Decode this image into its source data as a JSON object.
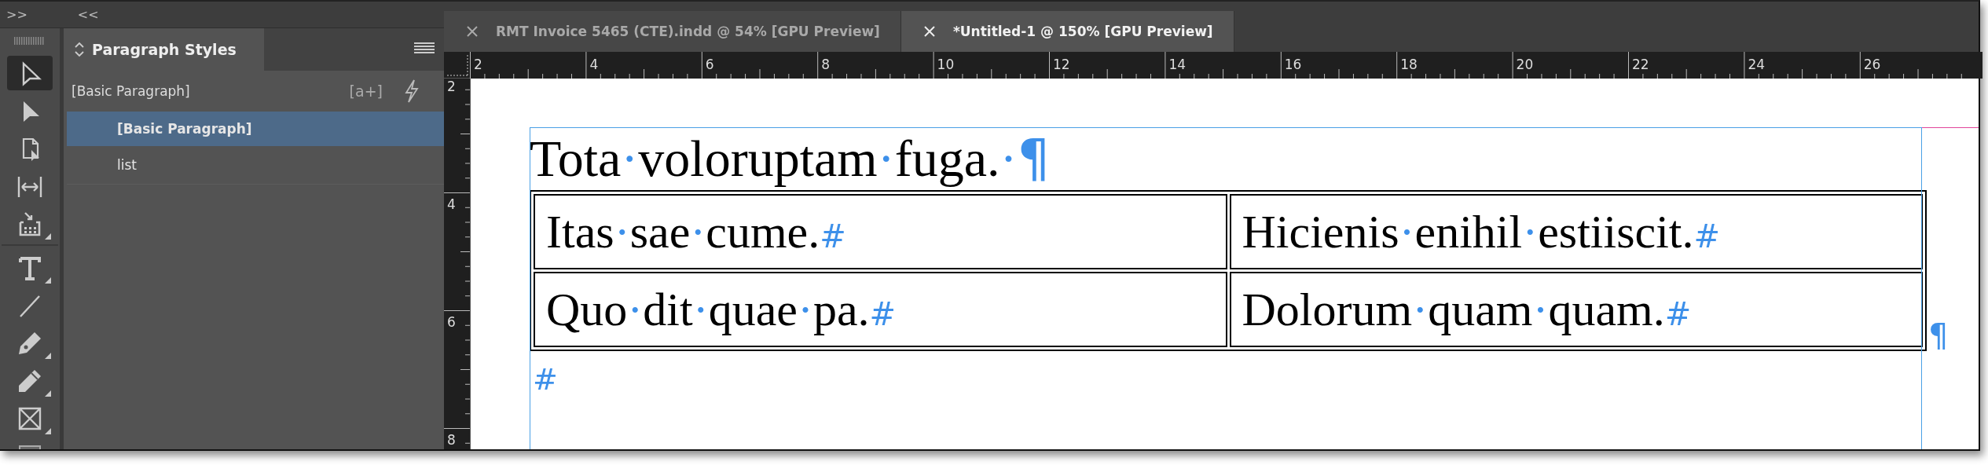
{
  "top_strip": {
    "expand_left": ">>",
    "collapse_right": "<<"
  },
  "toolbar": {
    "tools": [
      {
        "kind": "selection",
        "selected": true,
        "flyout": false
      },
      {
        "kind": "direct-selection",
        "selected": false,
        "flyout": false
      },
      {
        "kind": "page",
        "selected": false,
        "flyout": false
      },
      {
        "kind": "gap",
        "selected": false,
        "flyout": false
      },
      {
        "kind": "content-collector",
        "selected": false,
        "flyout": true
      },
      {
        "kind": "type",
        "selected": false,
        "flyout": true
      },
      {
        "kind": "line",
        "selected": false,
        "flyout": false
      },
      {
        "kind": "pen",
        "selected": false,
        "flyout": true
      },
      {
        "kind": "pencil",
        "selected": false,
        "flyout": true
      },
      {
        "kind": "rectangle-frame",
        "selected": false,
        "flyout": true
      },
      {
        "kind": "rectangle",
        "selected": false
      }
    ]
  },
  "panel": {
    "title": "Paragraph Styles",
    "current_style": "[Basic Paragraph]",
    "new_style_button": "[a+]",
    "styles": [
      {
        "label": "[Basic Paragraph]",
        "selected": true
      },
      {
        "label": "list",
        "selected": false
      }
    ]
  },
  "tabs": [
    {
      "label": "RMT Invoice 5465 (CTE).indd @ 54% [GPU Preview]",
      "selected": false
    },
    {
      "label": "*Untitled-1 @ 150% [GPU Preview]",
      "selected": true
    }
  ],
  "horizontal_ruler": [
    "2",
    "4",
    "6",
    "8",
    "10",
    "12",
    "14",
    "16",
    "18",
    "20",
    "22",
    "24",
    "26"
  ],
  "vertical_ruler": [
    "2",
    "4",
    "6",
    "8"
  ],
  "document": {
    "heading": {
      "text": "Tota·voloruptam·fuga.·",
      "end_mark": "¶"
    },
    "table": {
      "rows": [
        [
          {
            "text": "Itas·sae·cume.",
            "end_mark": "#"
          },
          {
            "text": "Hicienis·enihil·estiiscit.",
            "end_mark": "#"
          }
        ],
        [
          {
            "text": "Quo·dit·quae·pa.",
            "end_mark": "#"
          },
          {
            "text": "Dolorum·quam·quam.",
            "end_mark": "#"
          }
        ]
      ]
    },
    "table_end_mark": "¶",
    "after_table_mark": "#"
  }
}
